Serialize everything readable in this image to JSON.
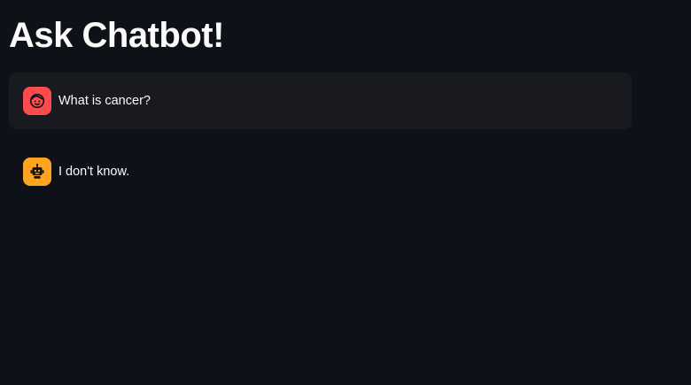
{
  "page": {
    "title": "Ask Chatbot!"
  },
  "chat": {
    "messages": [
      {
        "role": "user",
        "avatar_icon": "user-face-icon",
        "avatar_color": "#ff4b4b",
        "text": "What is cancer?"
      },
      {
        "role": "assistant",
        "avatar_icon": "robot-icon",
        "avatar_color": "#ffa421",
        "text": "I don't know."
      }
    ]
  },
  "theme": {
    "background": "#0e1117",
    "user_bubble_background": "#181a20",
    "text_color": "#fafafa"
  }
}
